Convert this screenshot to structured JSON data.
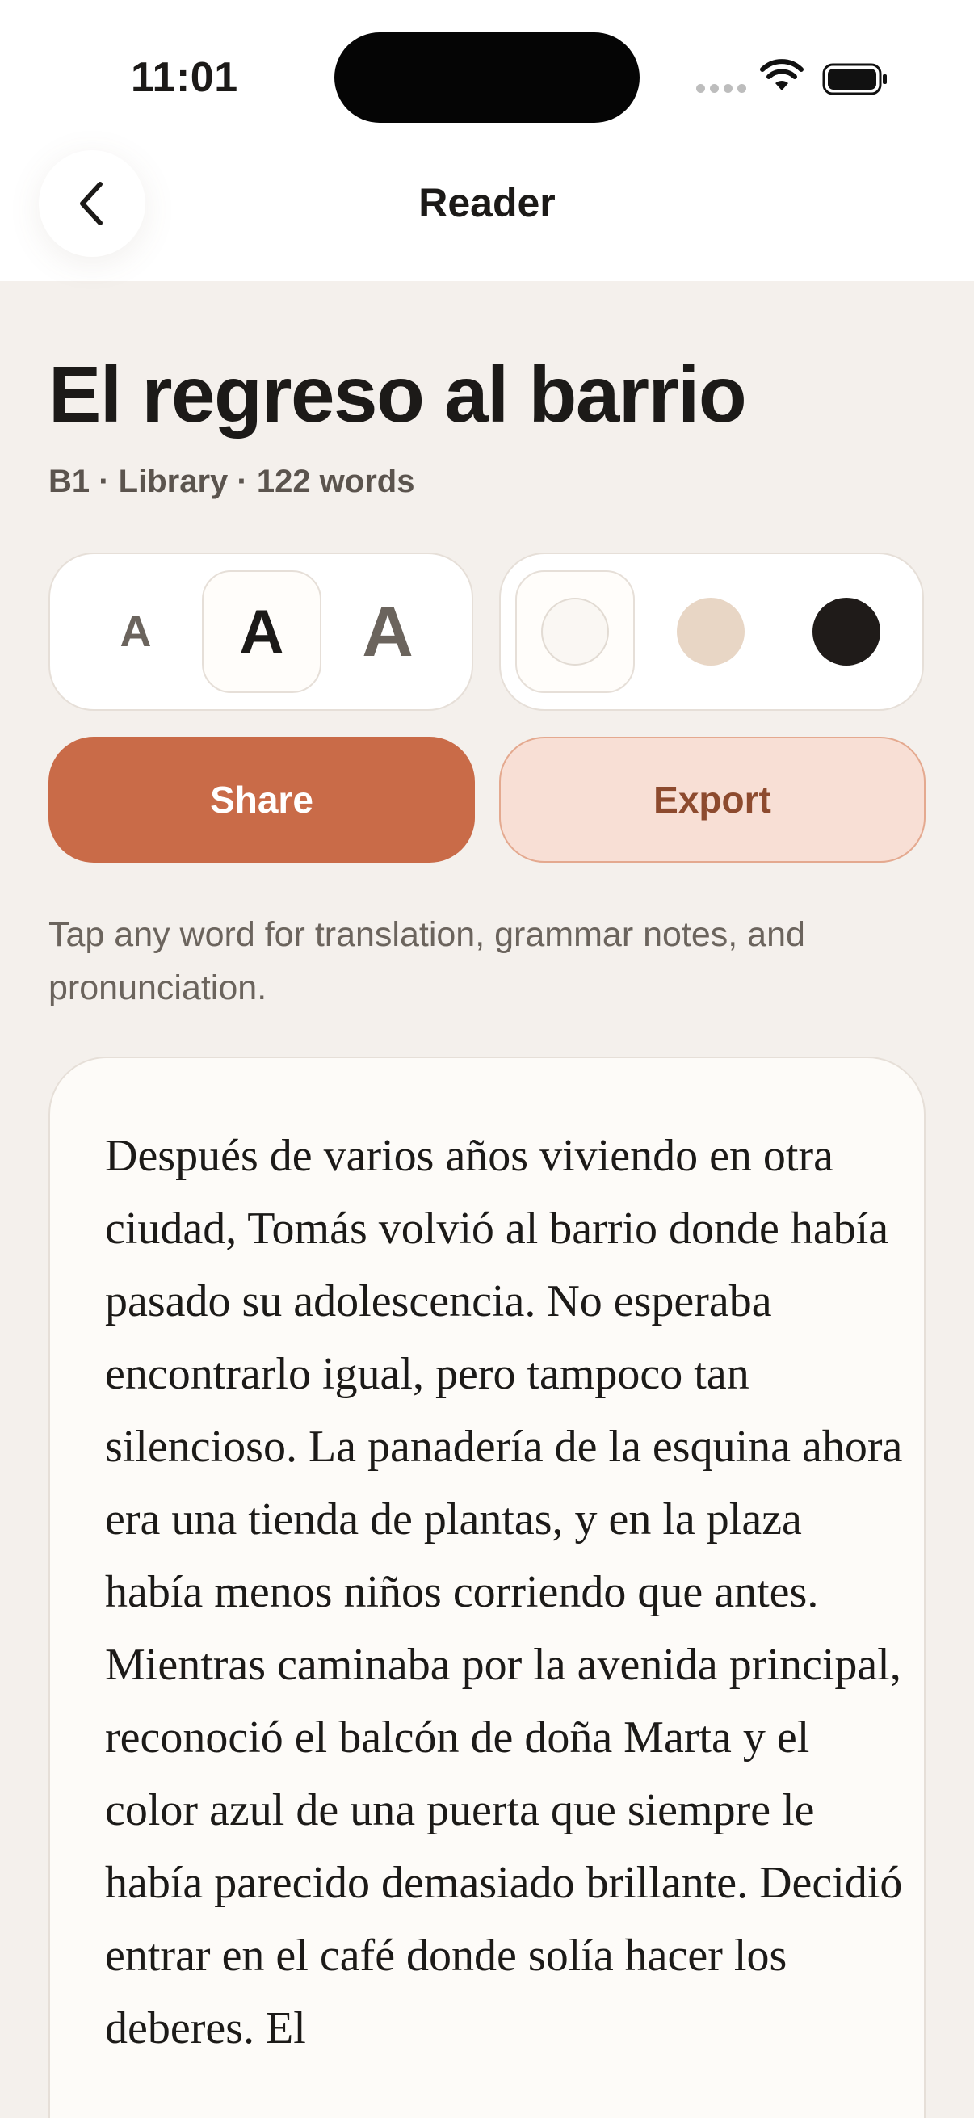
{
  "status_bar": {
    "time": "11:01"
  },
  "nav": {
    "title": "Reader",
    "back_icon": "chevron-left-icon"
  },
  "story": {
    "title": "El regreso al barrio",
    "meta": "B1 · Library · 122 words"
  },
  "text_size": {
    "options": [
      "A",
      "A",
      "A"
    ],
    "selected": 1
  },
  "theme": {
    "options": [
      {
        "name": "light",
        "color": "#faf7f3"
      },
      {
        "name": "sepia",
        "color": "#e8d6c5"
      },
      {
        "name": "dark",
        "color": "#1f1b19"
      }
    ],
    "selected": 0
  },
  "actions": {
    "share_label": "Share",
    "export_label": "Export"
  },
  "hint": "Tap any word for translation, grammar notes, and pronunciation.",
  "passage": {
    "text": "Después de varios años viviendo en otra ciudad, Tomás volvió al barrio donde había pasado su adolescencia. No esperaba encontrarlo igual, pero tampoco tan silencioso. La panadería de la esquina ahora era una tienda de plantas, y en la plaza había menos niños corriendo que antes. Mientras caminaba por la avenida principal, reconoció el balcón de doña Marta y el color azul de una puerta que siempre le había parecido demasiado brillante. Decidió entrar en el café donde solía hacer los deberes. El"
  },
  "colors": {
    "background": "#f4f0ec",
    "accent": "#c96b48",
    "accent_soft": "#f8dfd5",
    "text": "#1c1a18"
  }
}
